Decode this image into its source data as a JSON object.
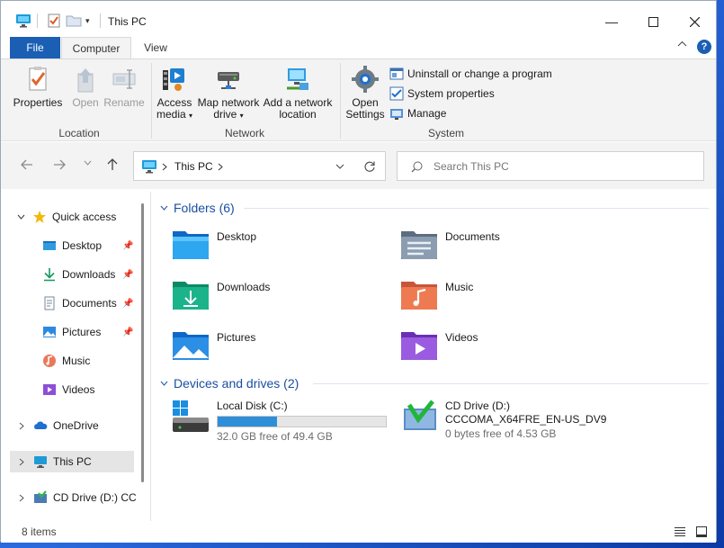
{
  "window": {
    "title": "This PC"
  },
  "tabs": [
    {
      "label": "File"
    },
    {
      "label": "Computer"
    },
    {
      "label": "View"
    }
  ],
  "ribbon": {
    "location": {
      "group_label": "Location",
      "properties": "Properties",
      "open": "Open",
      "rename": "Rename"
    },
    "network": {
      "group_label": "Network",
      "access_media_1": "Access",
      "access_media_2": "media",
      "map_drive_1": "Map network",
      "map_drive_2": "drive",
      "add_location_1": "Add a network",
      "add_location_2": "location"
    },
    "system": {
      "group_label": "System",
      "open_settings_1": "Open",
      "open_settings_2": "Settings",
      "uninstall": "Uninstall or change a program",
      "system_properties": "System properties",
      "manage": "Manage"
    }
  },
  "address": {
    "path": "This PC",
    "search_placeholder": "Search This PC"
  },
  "nav_pane": {
    "quick_access": "Quick access",
    "items": [
      {
        "label": "Desktop",
        "pinned": true
      },
      {
        "label": "Downloads",
        "pinned": true
      },
      {
        "label": "Documents",
        "pinned": true
      },
      {
        "label": "Pictures",
        "pinned": true
      },
      {
        "label": "Music",
        "pinned": false
      },
      {
        "label": "Videos",
        "pinned": false
      }
    ],
    "onedrive": "OneDrive",
    "this_pc": "This PC",
    "cd_drive": "CD Drive (D:) CCC"
  },
  "content": {
    "folders_header": "Folders (6)",
    "folders": [
      {
        "label": "Desktop"
      },
      {
        "label": "Documents"
      },
      {
        "label": "Downloads"
      },
      {
        "label": "Music"
      },
      {
        "label": "Pictures"
      },
      {
        "label": "Videos"
      }
    ],
    "devices_header": "Devices and drives (2)",
    "drives": [
      {
        "name": "Local Disk (C:)",
        "free_text": "32.0 GB free of 49.4 GB",
        "used_fraction": 0.352
      },
      {
        "name": "CD Drive (D:)",
        "volume": "CCCOMA_X64FRE_EN-US_DV9",
        "free_text": "0 bytes free of 4.53 GB"
      }
    ]
  },
  "status": {
    "item_count": "8 items"
  },
  "colors": {
    "accent": "#1a5fb4",
    "selection": "#e5e5e5",
    "drive_fill": "#2f8ed8"
  }
}
